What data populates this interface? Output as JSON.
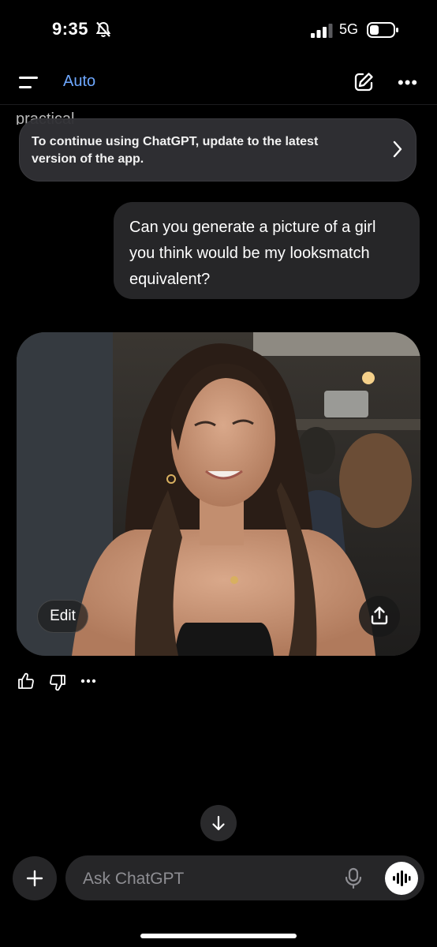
{
  "status_bar": {
    "time": "9:35",
    "network": "5G",
    "icons": [
      "bell-slash-icon",
      "signal-icon",
      "battery-icon"
    ]
  },
  "header": {
    "model_label": "Auto",
    "icons": [
      "menu-icon",
      "compose-icon",
      "more-icon"
    ]
  },
  "previous_text_fragment": "practical",
  "update_banner": {
    "text": "To continue using ChatGPT, update to the latest version of the app."
  },
  "user_message": {
    "text": "Can you generate a picture of a girl you think would be my looksmatch equivalent?"
  },
  "generated_image": {
    "edit_label": "Edit",
    "icons": [
      "share-icon"
    ]
  },
  "message_actions": {
    "icons": [
      "thumbs-up-icon",
      "thumbs-down-icon",
      "more-icon"
    ]
  },
  "composer": {
    "placeholder": "Ask ChatGPT",
    "icons": [
      "plus-icon",
      "mic-icon",
      "voice-mode-icon",
      "arrow-down-icon"
    ]
  },
  "colors": {
    "background": "#000000",
    "accent": "#6ea8ff",
    "bubble": "#262628",
    "banner": "#303034"
  }
}
